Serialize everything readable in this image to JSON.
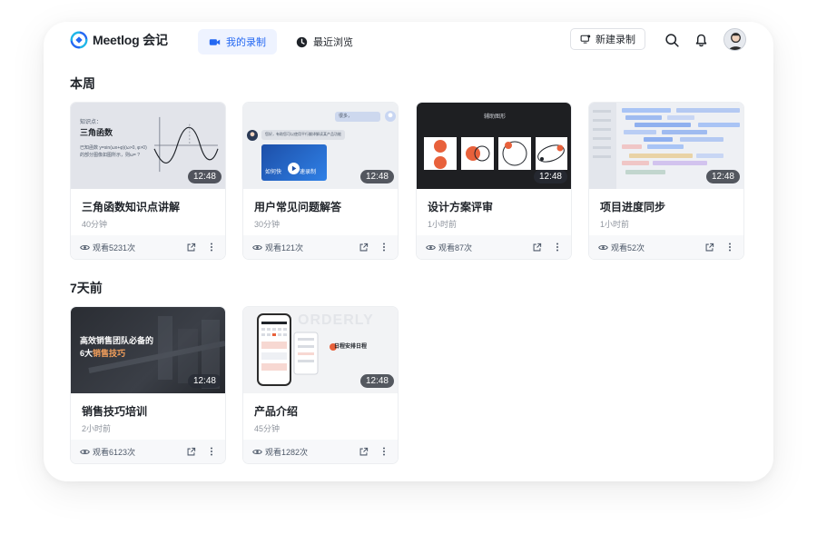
{
  "app": {
    "name": "Meetlog 会记",
    "brand_color": "#2468f2"
  },
  "nav": {
    "tabs": [
      {
        "label": "我的录制",
        "icon": "video-camera-icon",
        "active": true
      },
      {
        "label": "最近浏览",
        "icon": "clock-icon",
        "active": false
      }
    ],
    "new_recording_label": "新建录制",
    "icons": [
      "search-icon",
      "bell-icon",
      "avatar"
    ]
  },
  "sections": [
    {
      "title": "本周",
      "cards": [
        {
          "title": "三角函数知识点讲解",
          "length": "40分钟",
          "views": "观看5231次",
          "duration": "12:48",
          "thumb": {
            "heading": "知识点：",
            "subheading": "三角函数",
            "line1": "已知函数 y=sin(ωx+φ)(ω>0, φ>0)",
            "line2": "的部分图像如图所示，则ω= ?"
          }
        },
        {
          "title": "用户常见问题解答",
          "length": "30分钟",
          "views": "观看121次",
          "duration": "12:48",
          "thumb": {
            "question": "很多，",
            "answer": "您好，有助您可以使用平行翻译解读某产品功能",
            "video_caption_left": "如何快",
            "video_caption_right": "速录制"
          }
        },
        {
          "title": "设计方案评审",
          "length": "1小时前",
          "views": "观看87次",
          "duration": "12:48",
          "thumb": {
            "heading": "辅助图形"
          }
        },
        {
          "title": "项目进度同步",
          "length": "1小时前",
          "views": "观看52次",
          "duration": "12:48"
        }
      ]
    },
    {
      "title": "7天前",
      "cards": [
        {
          "title": "销售技巧培训",
          "length": "2小时前",
          "views": "观看6123次",
          "duration": "12:48",
          "thumb": {
            "line1": "高效销售团队必备的",
            "line2_white": "6大",
            "line2_accent": "销售技巧"
          }
        },
        {
          "title": "产品介绍",
          "length": "45分钟",
          "views": "观看1282次",
          "duration": "12:48",
          "thumb": {
            "label": "日程安排日程",
            "watermark": "ORDERLY"
          }
        }
      ]
    }
  ]
}
